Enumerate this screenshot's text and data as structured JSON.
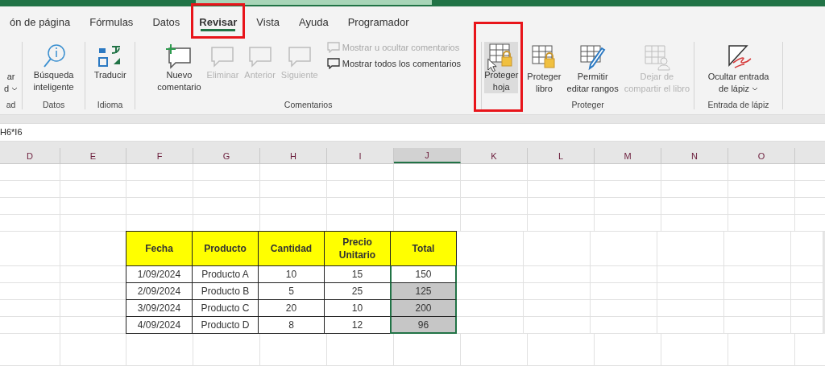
{
  "tabs": [
    {
      "label": "ón de página",
      "selected": false,
      "highlighted": false
    },
    {
      "label": "Fórmulas",
      "selected": false,
      "highlighted": false
    },
    {
      "label": "Datos",
      "selected": false,
      "highlighted": false
    },
    {
      "label": "Revisar",
      "selected": true,
      "highlighted": true
    },
    {
      "label": "Vista",
      "selected": false,
      "highlighted": false
    },
    {
      "label": "Ayuda",
      "selected": false,
      "highlighted": false
    },
    {
      "label": "Programador",
      "selected": false,
      "highlighted": false
    }
  ],
  "ribbon": {
    "groups": [
      {
        "label": "ad",
        "commands": [
          {
            "kind": "large",
            "lines": [
              "ar",
              "d"
            ],
            "dropdown": true,
            "disabled": false,
            "hovered": false,
            "highlighted": false
          }
        ]
      },
      {
        "label": "Datos",
        "commands": [
          {
            "kind": "large",
            "lines": [
              "Búsqueda",
              "inteligente"
            ],
            "dropdown": false,
            "disabled": false,
            "hovered": false,
            "highlighted": false
          }
        ]
      },
      {
        "label": "Idioma",
        "commands": [
          {
            "kind": "large",
            "lines": [
              "Traducir"
            ],
            "dropdown": false,
            "disabled": false,
            "hovered": false,
            "highlighted": false
          }
        ]
      },
      {
        "label": "Comentarios",
        "commands": [
          {
            "kind": "large",
            "lines": [
              "Nuevo",
              "comentario"
            ],
            "dropdown": false,
            "disabled": false,
            "hovered": false,
            "highlighted": false
          },
          {
            "kind": "large",
            "lines": [
              "Eliminar"
            ],
            "dropdown": false,
            "disabled": true,
            "hovered": false,
            "highlighted": false
          },
          {
            "kind": "large",
            "lines": [
              "Anterior"
            ],
            "dropdown": false,
            "disabled": true,
            "hovered": false,
            "highlighted": false
          },
          {
            "kind": "large",
            "lines": [
              "Siguiente"
            ],
            "dropdown": false,
            "disabled": true,
            "hovered": false,
            "highlighted": false
          },
          {
            "kind": "small",
            "lines": [
              "Mostrar u ocultar comentarios"
            ],
            "dropdown": false,
            "disabled": true,
            "hovered": false,
            "highlighted": false
          },
          {
            "kind": "small",
            "lines": [
              "Mostrar todos los comentarios"
            ],
            "dropdown": false,
            "disabled": false,
            "hovered": false,
            "highlighted": false
          }
        ]
      },
      {
        "label": "Proteger",
        "commands": [
          {
            "kind": "large",
            "lines": [
              "Proteger",
              "hoja"
            ],
            "dropdown": false,
            "disabled": false,
            "hovered": true,
            "highlighted": true
          },
          {
            "kind": "large",
            "lines": [
              "Proteger",
              "libro"
            ],
            "dropdown": false,
            "disabled": false,
            "hovered": false,
            "highlighted": false
          },
          {
            "kind": "large",
            "lines": [
              "Permitir",
              "editar rangos"
            ],
            "dropdown": false,
            "disabled": false,
            "hovered": false,
            "highlighted": false
          },
          {
            "kind": "large",
            "lines": [
              "Dejar de",
              "compartir el libro"
            ],
            "dropdown": false,
            "disabled": true,
            "hovered": false,
            "highlighted": false
          }
        ]
      },
      {
        "label": "Entrada de lápiz",
        "commands": [
          {
            "kind": "large",
            "lines": [
              "Ocultar entrada",
              "de lápiz"
            ],
            "dropdown": true,
            "disabled": false,
            "hovered": false,
            "highlighted": false
          }
        ]
      }
    ]
  },
  "formula_bar": {
    "formula": "H6*I6"
  },
  "sheet": {
    "columns": [
      {
        "label": "D",
        "selected": false
      },
      {
        "label": "E",
        "selected": false
      },
      {
        "label": "F",
        "selected": false
      },
      {
        "label": "G",
        "selected": false
      },
      {
        "label": "H",
        "selected": false
      },
      {
        "label": "I",
        "selected": false
      },
      {
        "label": "J",
        "selected": true
      },
      {
        "label": "K",
        "selected": false
      },
      {
        "label": "L",
        "selected": false
      },
      {
        "label": "M",
        "selected": false
      },
      {
        "label": "N",
        "selected": false
      },
      {
        "label": "O",
        "selected": false
      }
    ],
    "table": {
      "headers": [
        "Fecha",
        "Producto",
        "Cantidad",
        "Precio Unitario",
        "Total"
      ],
      "rows": [
        {
          "cells": [
            "1/09/2024",
            "Producto A",
            "10",
            "15",
            "150"
          ],
          "selected": true,
          "active": true
        },
        {
          "cells": [
            "2/09/2024",
            "Producto B",
            "5",
            "25",
            "125"
          ],
          "selected": true,
          "active": false
        },
        {
          "cells": [
            "3/09/2024",
            "Producto C",
            "20",
            "10",
            "200"
          ],
          "selected": true,
          "active": false
        },
        {
          "cells": [
            "4/09/2024",
            "Producto D",
            "8",
            "12",
            "96"
          ],
          "selected": true,
          "active": false
        }
      ]
    }
  }
}
